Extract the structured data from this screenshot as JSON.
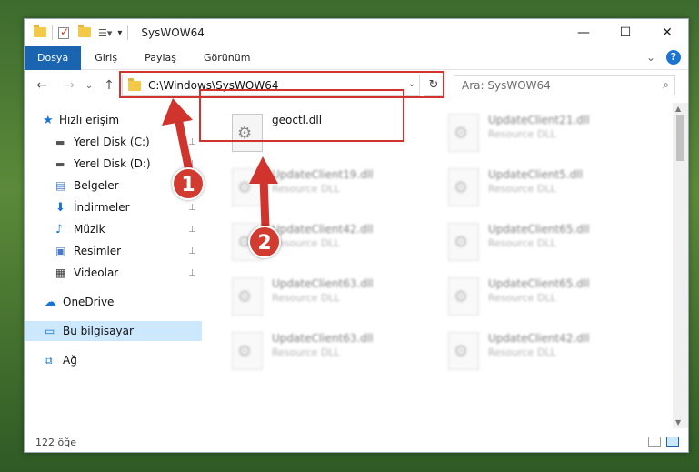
{
  "window": {
    "title": "SysWOW64",
    "minimize": "—",
    "maximize": "☐",
    "close": "✕"
  },
  "ribbon": {
    "tabs": [
      "Dosya",
      "Giriş",
      "Paylaş",
      "Görünüm"
    ],
    "expand_glyph": "⌄",
    "help_glyph": "?"
  },
  "nav": {
    "back": "←",
    "forward": "→",
    "recent": "⌄",
    "up": "↑",
    "address": "C:\\Windows\\SysWOW64",
    "address_dd": "⌄",
    "refresh": "↻",
    "search_placeholder": "Ara: SysWOW64",
    "search_glyph": "⌕"
  },
  "sidebar": {
    "items": [
      {
        "label": "Hızlı erişim",
        "icon": "star-icon"
      },
      {
        "label": "Yerel Disk (C:)",
        "icon": "drive-icon",
        "pinned": true
      },
      {
        "label": "Yerel Disk (D:)",
        "icon": "drive-icon",
        "pinned": true
      },
      {
        "label": "Belgeler",
        "icon": "document-icon",
        "pinned": true
      },
      {
        "label": "İndirmeler",
        "icon": "download-icon",
        "pinned": true
      },
      {
        "label": "Müzik",
        "icon": "music-icon",
        "pinned": true
      },
      {
        "label": "Resimler",
        "icon": "picture-icon",
        "pinned": true
      },
      {
        "label": "Videolar",
        "icon": "video-icon",
        "pinned": true
      },
      {
        "label": "OneDrive",
        "icon": "cloud-icon"
      },
      {
        "label": "Bu bilgisayar",
        "icon": "computer-icon"
      },
      {
        "label": "Ağ",
        "icon": "network-icon"
      }
    ],
    "pin_glyph": "📌"
  },
  "files": {
    "highlighted": {
      "name": "geoctl.dll"
    },
    "blurred": [
      {
        "name": "UpdateClient21.dll",
        "type": "Resource DLL"
      },
      {
        "name": "UpdateClient19.dll",
        "type": "Resource DLL"
      },
      {
        "name": "UpdateClient5.dll",
        "type": "Resource DLL"
      },
      {
        "name": "UpdateClient42.dll",
        "type": "Resource DLL"
      },
      {
        "name": "UpdateClient65.dll",
        "type": "Resource DLL"
      },
      {
        "name": "UpdateClient63.dll",
        "type": "Resource DLL"
      },
      {
        "name": "UpdateClient65.dll",
        "type": "Resource DLL"
      },
      {
        "name": "UpdateClient63.dll",
        "type": "Resource DLL"
      },
      {
        "name": "UpdateClient42.dll",
        "type": "Resource DLL"
      }
    ]
  },
  "status": {
    "count": "122 öğe"
  },
  "annotations": {
    "step1": "1",
    "step2": "2",
    "color": "#d0342c"
  }
}
